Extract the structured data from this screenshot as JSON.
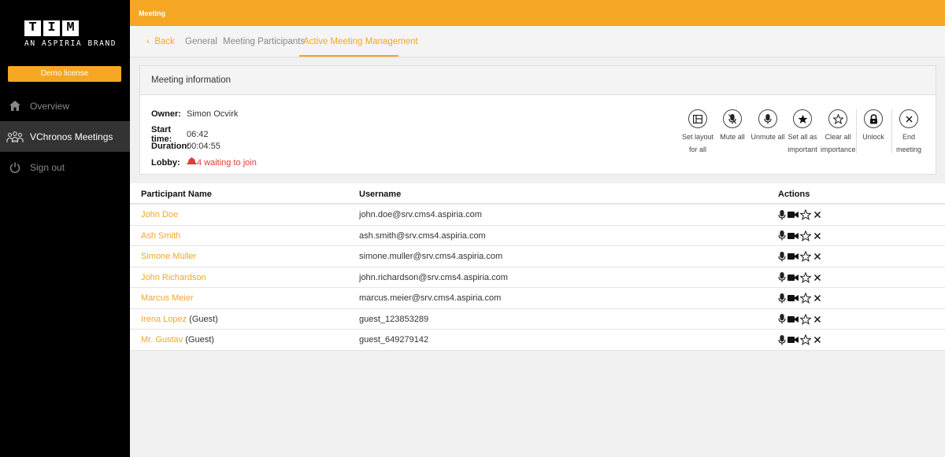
{
  "brand": {
    "letters": [
      "T",
      "I",
      "M"
    ],
    "subtitle": "AN ASPIRIA BRAND"
  },
  "sidebar": {
    "demo_label": "Demo license",
    "items": [
      {
        "label": "Overview",
        "icon": "home-icon"
      },
      {
        "label": "VChronos Meetings",
        "icon": "people-icon",
        "active": true
      },
      {
        "label": "Sign out",
        "icon": "power-icon"
      }
    ]
  },
  "topbar": {
    "title": "Meeting"
  },
  "tabs": {
    "back": "Back",
    "items": [
      "General",
      "Meeting Participants",
      "Active Meeting Management"
    ],
    "active": "Active Meeting Management"
  },
  "meeting_info": {
    "header": "Meeting information",
    "owner_label": "Owner:",
    "owner": "Simon Ocvirk",
    "start_label": "Start time:",
    "start": "06:42",
    "duration_label": "Duration:",
    "duration": "00:04:55",
    "lobby_label": "Lobby:",
    "lobby": "4 waiting to join"
  },
  "actions": {
    "set_layout": [
      "Set layout",
      "for all"
    ],
    "mute_all": [
      "Mute all"
    ],
    "unmute_all": [
      "Unmute all"
    ],
    "set_important": [
      "Set all as",
      "important"
    ],
    "clear_importance": [
      "Clear all",
      "importance"
    ],
    "unlock": [
      "Unlock"
    ],
    "end_meeting": [
      "End",
      "meeting"
    ]
  },
  "table": {
    "headers": {
      "name": "Participant Name",
      "username": "Username",
      "actions": "Actions"
    },
    "rows": [
      {
        "name": "John Doe",
        "guest": "",
        "username": "john.doe@srv.cms4.aspiria.com"
      },
      {
        "name": "Ash Smith",
        "guest": "",
        "username": "ash.smith@srv.cms4.aspiria.com"
      },
      {
        "name": "Simone Müller",
        "guest": "",
        "username": "simone.muller@srv.cms4.aspiria.com"
      },
      {
        "name": "John Richardson",
        "guest": "",
        "username": "john.richardson@srv.cms4.aspiria.com"
      },
      {
        "name": "Marcus Meier",
        "guest": "",
        "username": "marcus.meier@srv.cms4.aspiria.com"
      },
      {
        "name": "Irena Lopez",
        "guest": "(Guest)",
        "username": "guest_123853289"
      },
      {
        "name": "Mr. Gustav",
        "guest": "(Guest)",
        "username": "guest_649279142"
      }
    ]
  },
  "colors": {
    "accent": "#f5a623",
    "sidebar": "#000000",
    "lobby": "#e53935"
  }
}
